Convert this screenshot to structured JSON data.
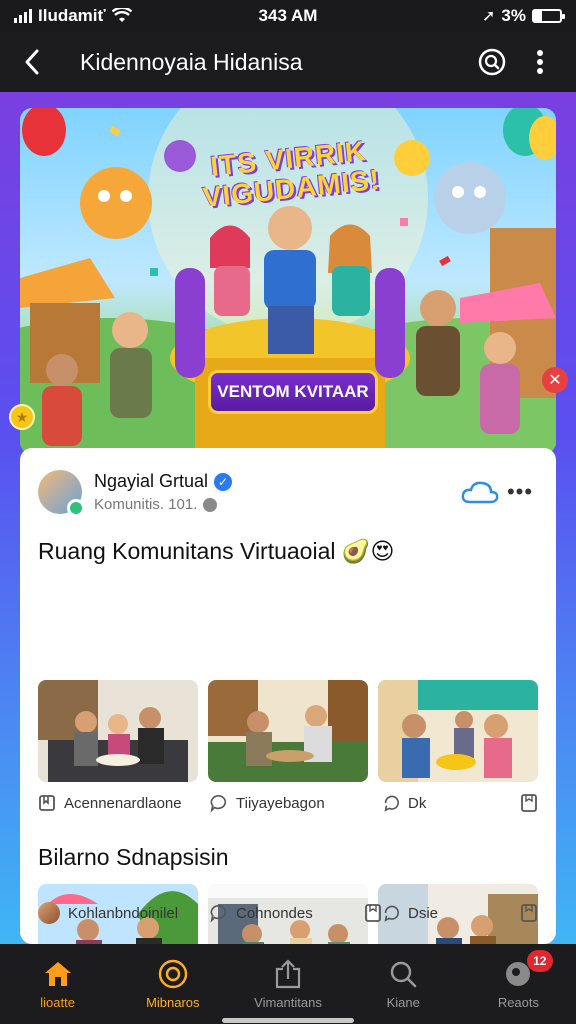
{
  "status_bar": {
    "carrier": "Iludamiť",
    "time": "343 AM",
    "battery": "3%",
    "battery_level": 0.3
  },
  "header": {
    "title": "Kidennoyaia Hidanisa"
  },
  "banner": {
    "headline": "ITS VIRRIK VIGUDAMIS!",
    "sign_text": "VENTOM KVITAAR",
    "accent_color": "#7a3fe0"
  },
  "post": {
    "author_name": "Ngayial Grtual",
    "author_sub": "Komunitis. 101.",
    "section1_title": "Ruang Komunitans Virtuaoial 🥑😍",
    "section1_actions": [
      {
        "label": "Acennenardlaone",
        "icon": "bookmark-outline-icon"
      },
      {
        "label": "Tiiyayebagon",
        "icon": "comment-icon"
      },
      {
        "label": "Dk",
        "icon": "share-icon"
      }
    ],
    "section2_title": "Bilarno Sdnapsisin",
    "section2_actions": [
      {
        "label": "Kohlanbndoinilel",
        "icon": "avatar"
      },
      {
        "label": "Cohnondes",
        "icon": "comment-icon"
      },
      {
        "label": "Dsie",
        "icon": "share-icon"
      }
    ]
  },
  "bottom_nav": {
    "items": [
      {
        "label": "lioatte",
        "icon": "home-icon"
      },
      {
        "label": "Mibnaros",
        "icon": "target-icon"
      },
      {
        "label": "Vimantitans",
        "icon": "upload-icon"
      },
      {
        "label": "Kiane",
        "icon": "search-icon"
      },
      {
        "label": "Reaots",
        "icon": "profile-icon"
      }
    ],
    "badge_count": "12"
  }
}
